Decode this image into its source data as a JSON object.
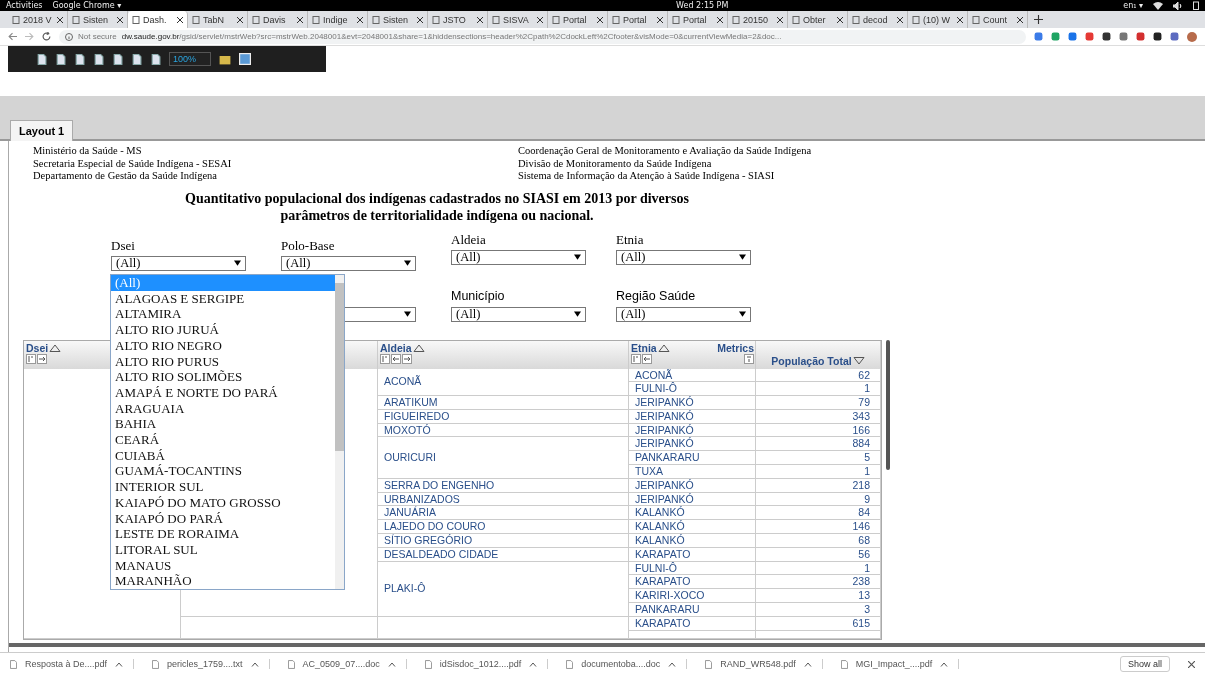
{
  "system_bar": {
    "activities": "Activities",
    "app": "Google Chrome ▾",
    "clock": "Wed 2:15 PM",
    "keyboard": "en₁ ▾"
  },
  "browser_tabs": [
    {
      "title": "2018 V",
      "selected": false
    },
    {
      "title": "Sisten",
      "selected": false
    },
    {
      "title": "Dash.",
      "selected": true
    },
    {
      "title": "TabN",
      "selected": false
    },
    {
      "title": "Davis",
      "selected": false
    },
    {
      "title": "Indige",
      "selected": false
    },
    {
      "title": "Sisten",
      "selected": false
    },
    {
      "title": "JSTO",
      "selected": false
    },
    {
      "title": "SISVA",
      "selected": false
    },
    {
      "title": "Portal",
      "selected": false
    },
    {
      "title": "Portal",
      "selected": false
    },
    {
      "title": "Portal",
      "selected": false
    },
    {
      "title": "20150",
      "selected": false
    },
    {
      "title": "Obter",
      "selected": false
    },
    {
      "title": "decod",
      "selected": false
    },
    {
      "title": "(10) W",
      "selected": false
    },
    {
      "title": "Count",
      "selected": false
    }
  ],
  "address_bar": {
    "security": "Not secure",
    "host": "dw.saude.gov.br",
    "path": "/gsid/servlet/mstrWeb?src=mstrWeb.2048001&evt=2048001&share=1&hiddensections=header%2Cpath%2CdockLeft%2Cfooter&visMode=0&currentViewMedia=2&doc..."
  },
  "toolbar": {
    "zoom": "100%"
  },
  "layout_tabs": [
    {
      "label": "Layout 1",
      "selected": true
    }
  ],
  "header_left": [
    "Ministério da Saúde - MS",
    "Secretaria Especial de Saúde Indígena - SESAI",
    "Departamento de Gestão da Saúde Indígena"
  ],
  "header_right": [
    "Coordenação Geral de Monitoramento e Avaliação da Saúde Indígena",
    "Divisão de Monitoramento da Saúde Indígena",
    "Sistema de Informação da Atenção à Saúde Indígena - SIASI"
  ],
  "title": [
    "Quantitativo populacional dos indígenas cadastrados no SIASI em 2013 por diversos",
    "parâmetros de territorialidade indígena ou nacional."
  ],
  "filters_row_1": [
    {
      "label": "Dsei",
      "value": "(All)"
    },
    {
      "label": "Polo-Base",
      "value": "(All)"
    },
    {
      "label": "Aldeia",
      "value": "(All)"
    },
    {
      "label": "Etnia",
      "value": "(All)"
    }
  ],
  "filters_row_2": [
    {
      "label": "Município",
      "value": "(All)"
    },
    {
      "label": "Região Saúde",
      "value": "(All)"
    }
  ],
  "dropdown_options": [
    {
      "label": "(All)",
      "selected": true
    },
    {
      "label": "ALAGOAS E SERGIPE",
      "selected": false
    },
    {
      "label": "ALTAMIRA",
      "selected": false
    },
    {
      "label": "ALTO RIO JURUÁ",
      "selected": false
    },
    {
      "label": "ALTO RIO NEGRO",
      "selected": false
    },
    {
      "label": "ALTO RIO PURUS",
      "selected": false
    },
    {
      "label": "ALTO RIO SOLIMÕES",
      "selected": false
    },
    {
      "label": "AMAPÁ E NORTE DO PARÁ",
      "selected": false
    },
    {
      "label": "ARAGUAIA",
      "selected": false
    },
    {
      "label": "BAHIA",
      "selected": false
    },
    {
      "label": "CEARÁ",
      "selected": false
    },
    {
      "label": "CUIABÁ",
      "selected": false
    },
    {
      "label": "GUAMÁ-TOCANTINS",
      "selected": false
    },
    {
      "label": "INTERIOR SUL",
      "selected": false
    },
    {
      "label": "KAIAPÓ DO MATO GROSSO",
      "selected": false
    },
    {
      "label": "KAIAPÓ DO PARÁ",
      "selected": false
    },
    {
      "label": "LESTE DE RORAIMA",
      "selected": false
    },
    {
      "label": "LITORAL SUL",
      "selected": false
    },
    {
      "label": "MANAUS",
      "selected": false
    },
    {
      "label": "MARANHÃO",
      "selected": false
    }
  ],
  "table": {
    "columns": [
      "Dsei",
      "Aldeia",
      "Etnia",
      "Metrics",
      "População Total"
    ],
    "groups": [
      {
        "aldeia": "ACONÃ",
        "rows": [
          {
            "etnia": "ACONÃ",
            "total": "62"
          },
          {
            "etnia": "FULNI-Ô",
            "total": "1"
          }
        ]
      },
      {
        "aldeia": "ARATIKUM",
        "rows": [
          {
            "etnia": "JERIPANKÓ",
            "total": "79"
          }
        ]
      },
      {
        "aldeia": "FIGUEIREDO",
        "rows": [
          {
            "etnia": "JERIPANKÓ",
            "total": "343"
          }
        ]
      },
      {
        "aldeia": "MOXOTÓ",
        "rows": [
          {
            "etnia": "JERIPANKÓ",
            "total": "166"
          }
        ]
      },
      {
        "aldeia": "OURICURI",
        "rows": [
          {
            "etnia": "JERIPANKÓ",
            "total": "884"
          },
          {
            "etnia": "PANKARARU",
            "total": "5"
          },
          {
            "etnia": "TUXA",
            "total": "1"
          }
        ]
      },
      {
        "aldeia": "SERRA DO ENGENHO",
        "rows": [
          {
            "etnia": "JERIPANKÓ",
            "total": "218"
          }
        ]
      },
      {
        "aldeia": "URBANIZADOS",
        "rows": [
          {
            "etnia": "JERIPANKÓ",
            "total": "9"
          }
        ]
      },
      {
        "aldeia": "JANUÁRIA",
        "rows": [
          {
            "etnia": "KALANKÓ",
            "total": "84"
          }
        ]
      },
      {
        "aldeia": "LAJEDO DO COURO",
        "rows": [
          {
            "etnia": "KALANKÓ",
            "total": "146"
          }
        ]
      },
      {
        "aldeia": "SÍTIO GREGÓRIO",
        "rows": [
          {
            "etnia": "KALANKÓ",
            "total": "68"
          }
        ]
      },
      {
        "aldeia": "DESALDEADO CIDADE",
        "rows": [
          {
            "etnia": "KARAPATO",
            "total": "56"
          }
        ]
      },
      {
        "aldeia": "PLAKI-Ô",
        "rows": [
          {
            "etnia": "FULNI-Ô",
            "total": "1"
          },
          {
            "etnia": "KARAPATO",
            "total": "238"
          },
          {
            "etnia": "KARIRI-XOCO",
            "total": "13"
          },
          {
            "etnia": "PANKARARU",
            "total": "3"
          }
        ]
      },
      {
        "rows": [
          {
            "etnia": "KARAPATO",
            "total": "615"
          }
        ]
      }
    ]
  },
  "downloads": [
    "Resposta à De....pdf",
    "pericles_1759....txt",
    "AC_0509_07....doc",
    "idSisdoc_1012....pdf",
    "documentoba....doc",
    "RAND_WR548.pdf",
    "MGI_Impact_....pdf"
  ],
  "show_all": "Show all"
}
